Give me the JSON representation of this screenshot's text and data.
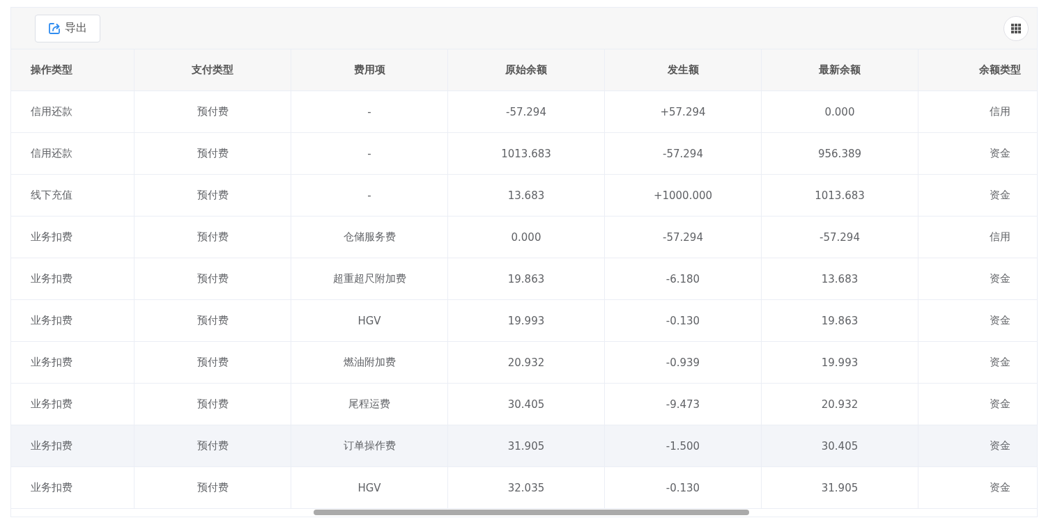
{
  "toolbar": {
    "export_button": "导出"
  },
  "table": {
    "columns": [
      {
        "label": "操作类型"
      },
      {
        "label": "支付类型"
      },
      {
        "label": "费用项"
      },
      {
        "label": "原始余额"
      },
      {
        "label": "发生额"
      },
      {
        "label": "最新余额"
      },
      {
        "label": "余额类型"
      }
    ],
    "rows": [
      {
        "hovered": false,
        "cells": [
          "信用还款",
          "预付费",
          "-",
          "-57.294",
          "+57.294",
          "0.000",
          "信用"
        ]
      },
      {
        "hovered": false,
        "cells": [
          "信用还款",
          "预付费",
          "-",
          "1013.683",
          "-57.294",
          "956.389",
          "资金"
        ]
      },
      {
        "hovered": false,
        "cells": [
          "线下充值",
          "预付费",
          "-",
          "13.683",
          "+1000.000",
          "1013.683",
          "资金"
        ]
      },
      {
        "hovered": false,
        "cells": [
          "业务扣费",
          "预付费",
          "仓储服务费",
          "0.000",
          "-57.294",
          "-57.294",
          "信用"
        ]
      },
      {
        "hovered": false,
        "cells": [
          "业务扣费",
          "预付费",
          "超重超尺附加费",
          "19.863",
          "-6.180",
          "13.683",
          "资金"
        ]
      },
      {
        "hovered": false,
        "cells": [
          "业务扣费",
          "预付费",
          "HGV",
          "19.993",
          "-0.130",
          "19.863",
          "资金"
        ]
      },
      {
        "hovered": false,
        "cells": [
          "业务扣费",
          "预付费",
          "燃油附加费",
          "20.932",
          "-0.939",
          "19.993",
          "资金"
        ]
      },
      {
        "hovered": false,
        "cells": [
          "业务扣费",
          "预付费",
          "尾程运费",
          "30.405",
          "-9.473",
          "20.932",
          "资金"
        ]
      },
      {
        "hovered": true,
        "cells": [
          "业务扣费",
          "预付费",
          "订单操作费",
          "31.905",
          "-1.500",
          "30.405",
          "资金"
        ]
      },
      {
        "hovered": false,
        "cells": [
          "业务扣费",
          "预付费",
          "HGV",
          "32.035",
          "-0.130",
          "31.905",
          "资金"
        ]
      }
    ]
  }
}
